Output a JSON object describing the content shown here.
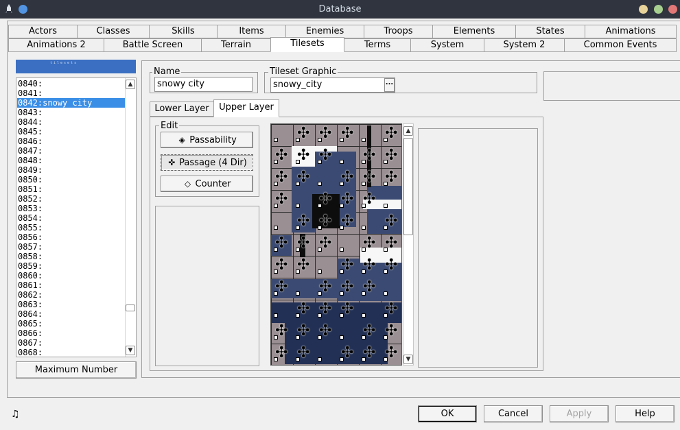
{
  "window": {
    "title": "Database"
  },
  "tabs_row1": [
    "Actors",
    "Classes",
    "Skills",
    "Items",
    "Enemies",
    "Troops",
    "Elements",
    "States",
    "Animations"
  ],
  "tabs_row2": [
    "Animations 2",
    "Battle Screen",
    "Terrain",
    "Tilesets",
    "Terms",
    "System",
    "System 2",
    "Common Events"
  ],
  "active_tab": "Tilesets",
  "list": {
    "items": [
      "0840:",
      "0841:",
      "0842:snowy city",
      "0843:",
      "0844:",
      "0845:",
      "0846:",
      "0847:",
      "0848:",
      "0849:",
      "0850:",
      "0851:",
      "0852:",
      "0853:",
      "0854:",
      "0855:",
      "0856:",
      "0857:",
      "0858:",
      "0859:",
      "0860:",
      "0861:",
      "0862:",
      "0863:",
      "0864:",
      "0865:",
      "0866:",
      "0867:",
      "0868:"
    ],
    "selected": "0842:snowy city",
    "max_button": "Maximum Number"
  },
  "form": {
    "name_label": "Name",
    "name_value": "snowy city",
    "graphic_label": "Tileset Graphic",
    "graphic_value": "snowy_city",
    "browse_label": "..."
  },
  "layer_tabs": [
    "Lower Layer",
    "Upper Layer"
  ],
  "active_layer": "Upper Layer",
  "edit": {
    "label": "Edit",
    "passability": "Passability",
    "passage": "Passage (4 Dir)",
    "counter": "Counter",
    "active_mode": "Passage (4 Dir)"
  },
  "footer": {
    "ok": "OK",
    "cancel": "Cancel",
    "apply": "Apply",
    "help": "Help"
  },
  "colors": {
    "titlebar": "#2f343f",
    "selection": "#3a8ee6",
    "banner": "#3a6fc2"
  },
  "icons": {
    "app": "rocket-icon",
    "footer": "music-note-icon"
  }
}
